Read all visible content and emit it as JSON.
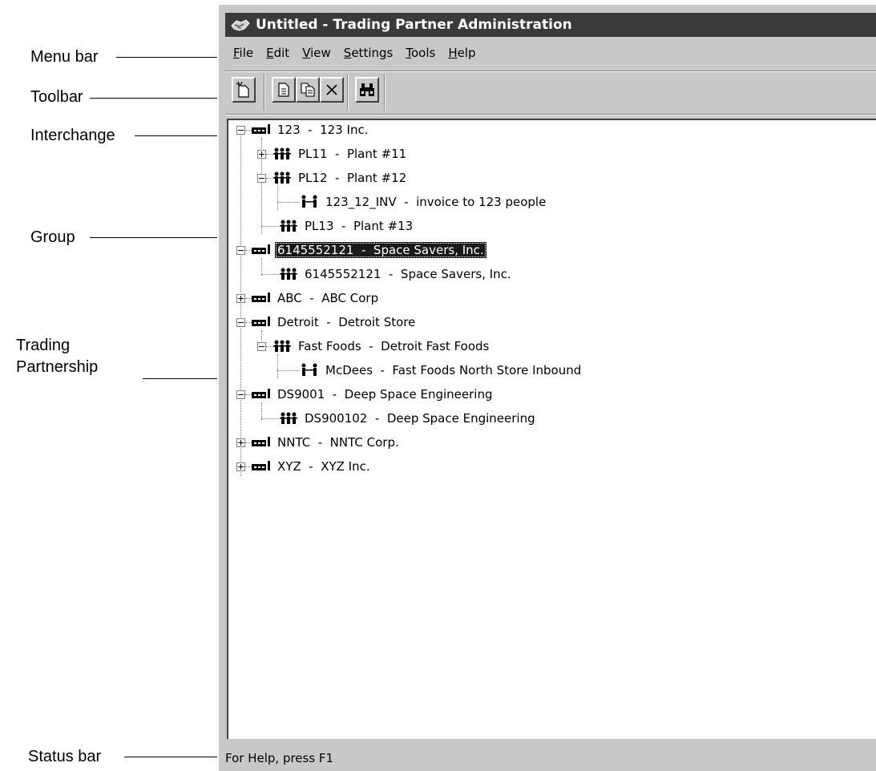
{
  "callouts": {
    "menu_bar": "Menu bar",
    "toolbar": "Toolbar",
    "interchange": "Interchange",
    "group": "Group",
    "trading_partnership_1": "Trading",
    "trading_partnership_2": "Partnership",
    "status_bar": "Status bar"
  },
  "window": {
    "title": "Untitled - Trading Partner Administration"
  },
  "menu": {
    "file": "File",
    "edit": "Edit",
    "view": "View",
    "settings": "Settings",
    "tools": "Tools",
    "help": "Help"
  },
  "toolbar": {
    "icons": [
      "new-icon",
      "properties-icon",
      "copy-icon",
      "delete-icon",
      "find-icon"
    ]
  },
  "tree": {
    "nodes": [
      {
        "type": "interchange",
        "label": "123  -  123 Inc."
      },
      {
        "type": "group",
        "label": "PL11  -  Plant #11"
      },
      {
        "type": "group",
        "label": "PL12  -  Plant #12"
      },
      {
        "type": "partnership",
        "label": "123_12_INV  -  invoice to 123 people"
      },
      {
        "type": "group",
        "label": "PL13  -  Plant #13"
      },
      {
        "type": "interchange",
        "label": "6145552121  -  Space Savers, Inc.",
        "selected": true
      },
      {
        "type": "group",
        "label": "6145552121  -  Space Savers, Inc."
      },
      {
        "type": "interchange",
        "label": "ABC  -  ABC Corp"
      },
      {
        "type": "interchange",
        "label": "Detroit  -  Detroit Store"
      },
      {
        "type": "group",
        "label": "Fast Foods  -  Detroit Fast Foods"
      },
      {
        "type": "partnership",
        "label": "McDees  -  Fast Foods North Store Inbound"
      },
      {
        "type": "interchange",
        "label": "DS9001  -  Deep Space Engineering"
      },
      {
        "type": "group",
        "label": "DS900102  -  Deep Space Engineering"
      },
      {
        "type": "interchange",
        "label": "NNTC  -  NNTC Corp."
      },
      {
        "type": "interchange",
        "label": "XYZ  -  XYZ Inc."
      }
    ]
  },
  "status": {
    "text": "For Help, press F1"
  },
  "colors": {
    "titlebar": "#3a3a3a",
    "chrome": "#c8c8c8",
    "selection": "#1a1a1a"
  }
}
